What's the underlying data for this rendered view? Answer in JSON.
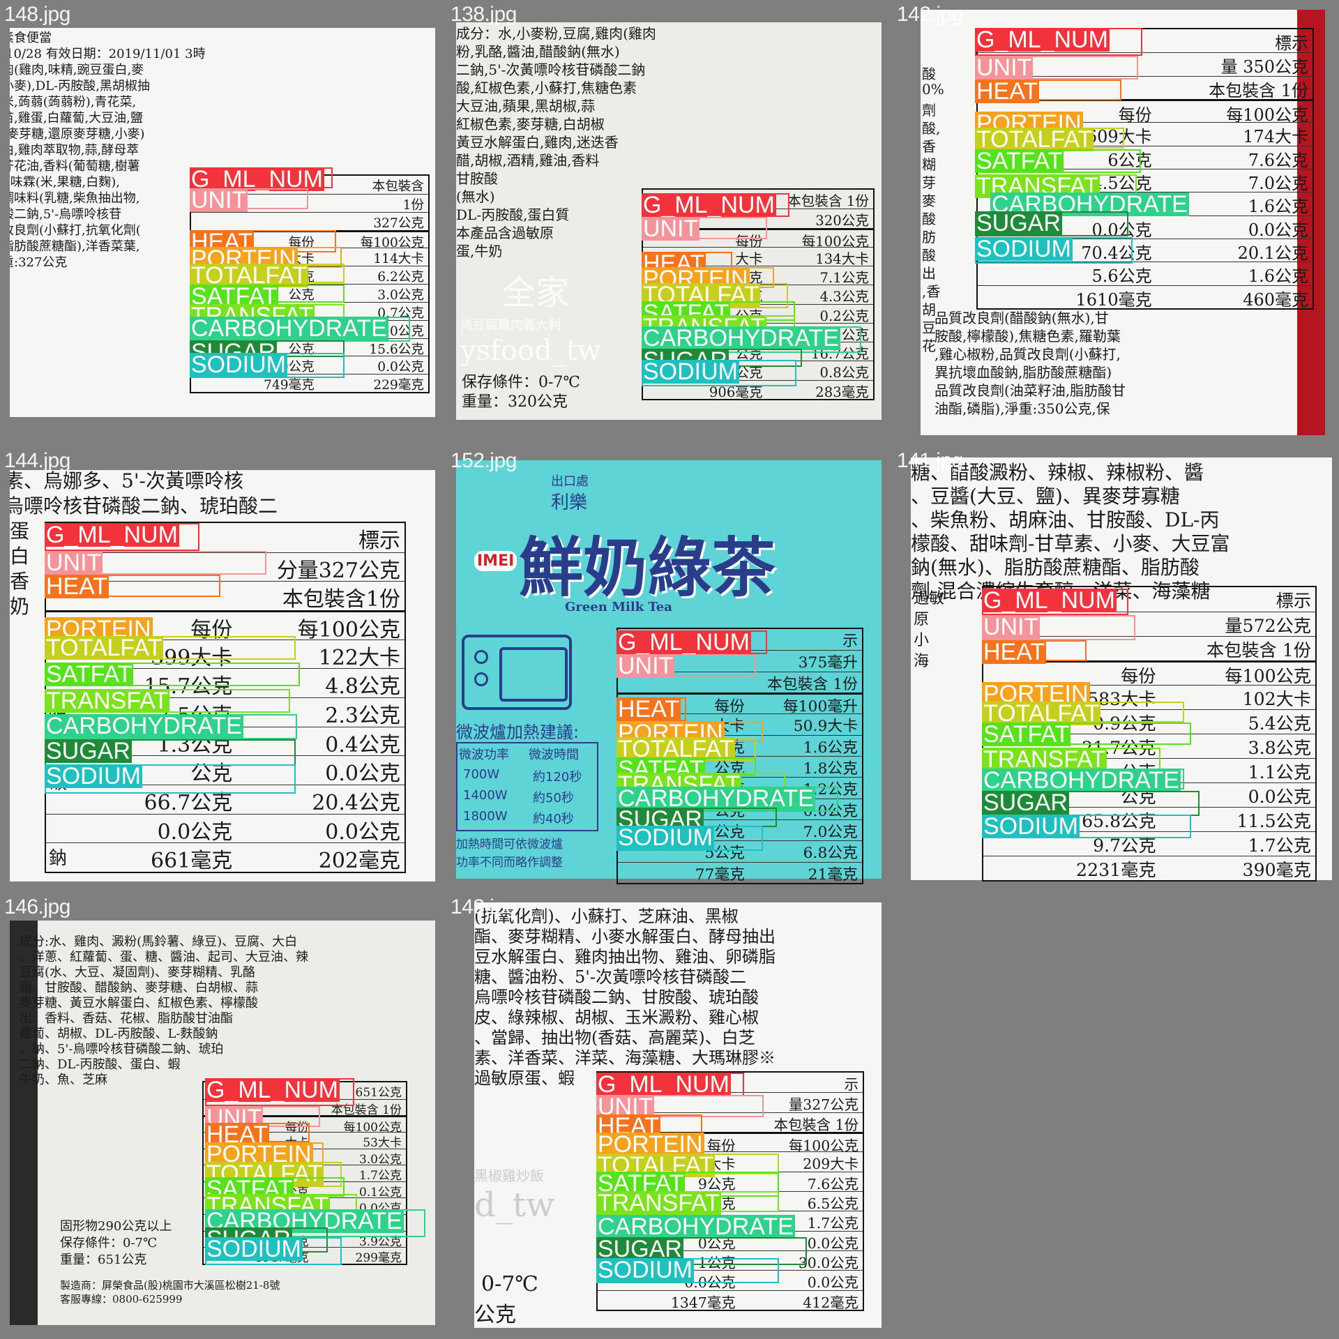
{
  "title": "Nutrition label detections grid",
  "class_colors": {
    "G_ML_NUM": "#f2333b",
    "UNIT": "#f5939a",
    "HEAT": "#f5731c",
    "PORTEIN": "#f5a21c",
    "TOTALFAT": "#c6cf1c",
    "SATFAT": "#57e31c",
    "TRANSFAT": "#7be31c",
    "CARBOHYDRATE": "#2fd28a",
    "SUGAR": "#1f8a38",
    "SODIUM": "#1fc0c0"
  },
  "tiles": [
    {
      "filename": "148.jpg",
      "text_lines": [
        "素食便當",
        "/10/28        有效日期：2019/11/01        3時",
        "肉(雞肉,味精,豌豆蛋白,麥",
        "小麥),DL-丙胺酸,黑胡椒抽",
        "米,蒟蒻(蒟蒻粉),青花菜,",
        "苗,雞蛋,白蘿蔔,大豆油,鹽",
        "(麥芽糖,還原麥芽糖,小麥)",
        "由,雞肉萃取物,蒜,酵母萃",
        "芥花油,香料(葡萄糖,樹薯",
        "),味霖(米,果糖,白麴),",
        "調味料(乳糖,柴魚抽出物,",
        "酸二鈉,5'-烏嘌呤核苷",
        "改良劑(小蘇打,抗氧化劑(",
        "脂肪酸蔗糖酯),洋香菜葉,",
        "重:327公克"
      ],
      "table": [
        [
          "每份",
          "每100公克"
        ],
        [
          "大卡",
          "114大卡"
        ],
        [
          "公克",
          "6.2公克"
        ],
        [
          "公克",
          "3.0公克"
        ],
        [
          "公克",
          "0.7公克"
        ],
        [
          "公克",
          "0.0公克"
        ],
        [
          "公克",
          "15.6公克"
        ],
        [
          "0公克",
          "0.0公克"
        ],
        [
          "749毫克",
          "229毫克"
        ]
      ],
      "table_head": [
        "本包裝含",
        "1份",
        "327公克"
      ]
    },
    {
      "filename": "138.jpg",
      "text_lines": [
        "成分：水,小麥粉,豆腐,雞肉(雞肉",
        "粉,乳酪,醬油,醋酸鈉(無水)",
        "二鈉,5'-次黃嘌呤核苷磷酸二鈉",
        "酸,紅椒色素,小蘇打,焦糖色素",
        "大豆油,蘋果,黑胡椒,蒜",
        "紅椒色素,麥芽糖,白胡椒",
        "黃豆水解蛋白,雞肉,迷迭香",
        "醋,胡椒,酒精,雞油,香料",
        "甘胺酸",
        "(無水)",
        "DL-丙胺酸,蛋白質",
        "本產品含過敏原",
        "蛋,牛奶"
      ],
      "watermark1": "全家",
      "watermark2": "烤豆腐雞肉義大利",
      "watermark3": "ysfood_tw",
      "storage": "保存條件：0-7℃",
      "weight": "重量：320公克",
      "table_head": [
        "本包裝含 1份",
        "320公克"
      ],
      "table": [
        [
          "每份",
          "每100公克"
        ],
        [
          "大卡",
          "134大卡"
        ],
        [
          "公克",
          "7.1公克"
        ],
        [
          "公克",
          "4.3公克"
        ],
        [
          "公克",
          "0.2公克"
        ],
        [
          "公克",
          "0.1公克"
        ],
        [
          "公克",
          "16.7公克"
        ],
        [
          "6公克",
          "0.8公克"
        ],
        [
          "906毫克",
          "283毫克"
        ]
      ]
    },
    {
      "filename": "142.jpg",
      "text_lines": [
        "品質改良劑(醋酸鈉(無水),甘",
        "胺酸,檸檬酸),焦糖色素,羅勒葉",
        ",雞心椒粉,品質改良劑(小蘇打,",
        "異抗壞血酸鈉,脂肪酸蔗糖酯)",
        "品質改良劑(油菜籽油,脂肪酸甘",
        "油酯,磷脂),淨重:350公克,保"
      ],
      "left_lines": [
        "酸",
        "0%",
        "劑",
        "酸,",
        "香",
        "糊",
        "芽",
        "麥",
        "酸",
        "肪",
        "酸",
        "出",
        ",香",
        "胡",
        "豆",
        "花"
      ],
      "table_head": [
        "標示",
        "量 350公克",
        "本包裝含 1份"
      ],
      "table": [
        [
          "每份",
          "每100公克"
        ],
        [
          "609大卡",
          "174大卡"
        ],
        [
          "6公克",
          "7.6公克"
        ],
        [
          "4.5公克",
          "7.0公克"
        ],
        [
          "公克",
          "1.6公克"
        ],
        [
          "0.0公克",
          "0.0公克"
        ],
        [
          "70.4公克",
          "20.1公克"
        ],
        [
          "5.6公克",
          "1.6公克"
        ],
        [
          "1610毫克",
          "460毫克"
        ]
      ]
    },
    {
      "filename": "144.jpg",
      "text_lines": [
        "素、烏娜多、5'-次黃嘌呤核",
        "烏嘌呤核苷磷酸二鈉、琥珀酸二"
      ],
      "table_head": [
        "標示",
        "分量327公克",
        "本包裝含1份"
      ],
      "table": [
        [
          "每份",
          "每100公克"
        ],
        [
          "399大卡",
          "122大卡"
        ],
        [
          "15.7公克",
          "4.8公克"
        ],
        [
          "7.5公克",
          "2.3公克"
        ],
        [
          "1.3公克",
          "0.4公克"
        ],
        [
          "公克",
          "0.0公克"
        ],
        [
          "66.7公克",
          "20.4公克"
        ],
        [
          "0.0公克",
          "0.0公克"
        ],
        [
          "661毫克",
          "202毫克"
        ]
      ],
      "left_chars": [
        "蛋",
        "白",
        "香",
        "奶"
      ],
      "row_chars": [
        "脂",
        "碳",
        "鈉"
      ]
    },
    {
      "filename": "152.jpg",
      "top_labels": [
        "出口處",
        "利樂"
      ],
      "brand": "IMEI",
      "product": "鮮奶綠茶",
      "product_en": "Green Milk Tea",
      "microwave_title": "微波爐加熱建議:",
      "microwave_head": [
        "微波功率",
        "微波時間"
      ],
      "microwave_rows": [
        [
          "700W",
          "約120秒"
        ],
        [
          "1400W",
          "約50秒"
        ],
        [
          "1800W",
          "約40秒"
        ]
      ],
      "microwave_note": [
        "加熱時間可依微波爐",
        "功率不同而略作調整"
      ],
      "table_head": [
        "示",
        "375毫升",
        "本包裝含 1份"
      ],
      "table": [
        [
          "每份",
          "每100毫升"
        ],
        [
          "大卡",
          "50.9大卡"
        ],
        [
          "公克",
          "1.6公克"
        ],
        [
          "公克",
          "1.8公克"
        ],
        [
          "公克",
          "1.2公克"
        ],
        [
          "公克",
          "0.0公克"
        ],
        [
          "2公克",
          "7.0公克"
        ],
        [
          "5公克",
          "6.8公克"
        ],
        [
          "77毫克",
          "21毫克"
        ]
      ]
    },
    {
      "filename": "141.jpg",
      "text_lines": [
        "糖、醋酸澱粉、辣椒、辣椒粉、醬",
        "、豆醬(大豆、鹽)、異麥芽寡糖",
        "、柴魚粉、胡麻油、甘胺酸、DL-丙",
        "檬酸、甜味劑-甘草素、小麥、大豆富",
        "鈉(無水)、脂肪酸蔗糖酯、脂肪酸",
        "劑-混合濃縮生育醇、洋菜、海藻糖"
      ],
      "left_chars": [
        "過敏",
        "原",
        "小",
        "海"
      ],
      "table_head": [
        "標示",
        "量572公克",
        "本包裝含 1份"
      ],
      "table": [
        [
          "每份",
          "每100公克"
        ],
        [
          "583大卡",
          "102大卡"
        ],
        [
          "0.9公克",
          "5.4公克"
        ],
        [
          "21.7公克",
          "3.8公克"
        ],
        [
          "公克",
          "1.1公克"
        ],
        [
          "公克",
          "0.0公克"
        ],
        [
          "65.8公克",
          "11.5公克"
        ],
        [
          "9.7公克",
          "1.7公克"
        ],
        [
          "2231毫克",
          "390毫克"
        ]
      ]
    },
    {
      "filename": "146.jpg",
      "text_lines": [
        "成分:水、雞肉、澱粉(馬鈴薯、綠豆)、豆腐、大白",
        "、洋蔥、紅蘿蔔、蛋、糖、醬油、起司、大豆油、辣",
        "豆腐(水、大豆、凝固劑)、麥芽糊精、乳酪",
        "脂、甘胺酸、醋酸鈉、麥芽糖、白胡椒、蒜",
        "麥芽糖、黃豆水解蛋白、紅椒色素、檸檬酸",
        "出、香料、香菇、花椒、脂肪酸甘油酯",
        "蘿蔔、胡椒、DL-丙胺酸、L-麩酸鈉",
        "、鈉、5'-烏嘌呤核苷磷酸二鈉、琥珀",
        "二鈉、DL-丙胺酸、蛋白、蝦",
        "牛奶、魚、芝麻"
      ],
      "solids": "固形物290公克以上",
      "storage": "保存條件：0-7℃",
      "weight": "重量：651公克",
      "maker": "製造商：屏榮食品(股)桃園市大溪區松樹21-8號",
      "hotline": "客服專線：0800-625999",
      "table_head": [
        "651公克",
        "本包裝含 1份"
      ],
      "table": [
        [
          "每份",
          "每100公克"
        ],
        [
          "大卡",
          "53大卡"
        ],
        [
          "公克",
          "3.0公克"
        ],
        [
          "公克",
          "1.7公克"
        ],
        [
          "公克",
          "0.1公克"
        ],
        [
          "公克",
          "0.0公克"
        ],
        [
          "公克",
          "5.0公克"
        ],
        [
          "公克",
          "3.9公克"
        ],
        [
          "1947毫克",
          "299毫克"
        ]
      ]
    },
    {
      "filename": "143.jpg",
      "text_lines": [
        "(抗氧化劑)、小蘇打、芝麻油、黑椒",
        "酯、麥芽糊精、小麥水解蛋白、酵母抽出",
        "豆水解蛋白、雞肉抽出物、雞油、卵磷脂",
        "糖、醬油粉、5'-次黃嘌呤核苷磷酸二",
        "烏嘌呤核苷磷酸二鈉、甘胺酸、琥珀酸",
        "皮、綠辣椒、胡椒、玉米澱粉、雞心椒",
        "、當歸、抽出物(香菇、高麗菜)、白芝",
        "素、洋香菜、洋菜、海藻糖、大瑪琳膠※",
        "過敏原蛋、蝦"
      ],
      "watermark1": "黑椒雞炒飯",
      "watermark2": "d_tw",
      "storage": "0-7℃",
      "weight": "公克",
      "table_head": [
        "示",
        "量327公克",
        "本包裝含 1份"
      ],
      "table": [
        [
          "每份",
          "每100公克"
        ],
        [
          "683大卡",
          "209大卡"
        ],
        [
          "9公克",
          "7.6公克"
        ],
        [
          "3公克",
          "6.5公克"
        ],
        [
          "公克",
          "1.7公克"
        ],
        [
          "0公克",
          "0.0公克"
        ],
        [
          "1公克",
          "30.0公克"
        ],
        [
          "0.0公克",
          "0.0公克"
        ],
        [
          "1347毫克",
          "412毫克"
        ]
      ]
    }
  ]
}
